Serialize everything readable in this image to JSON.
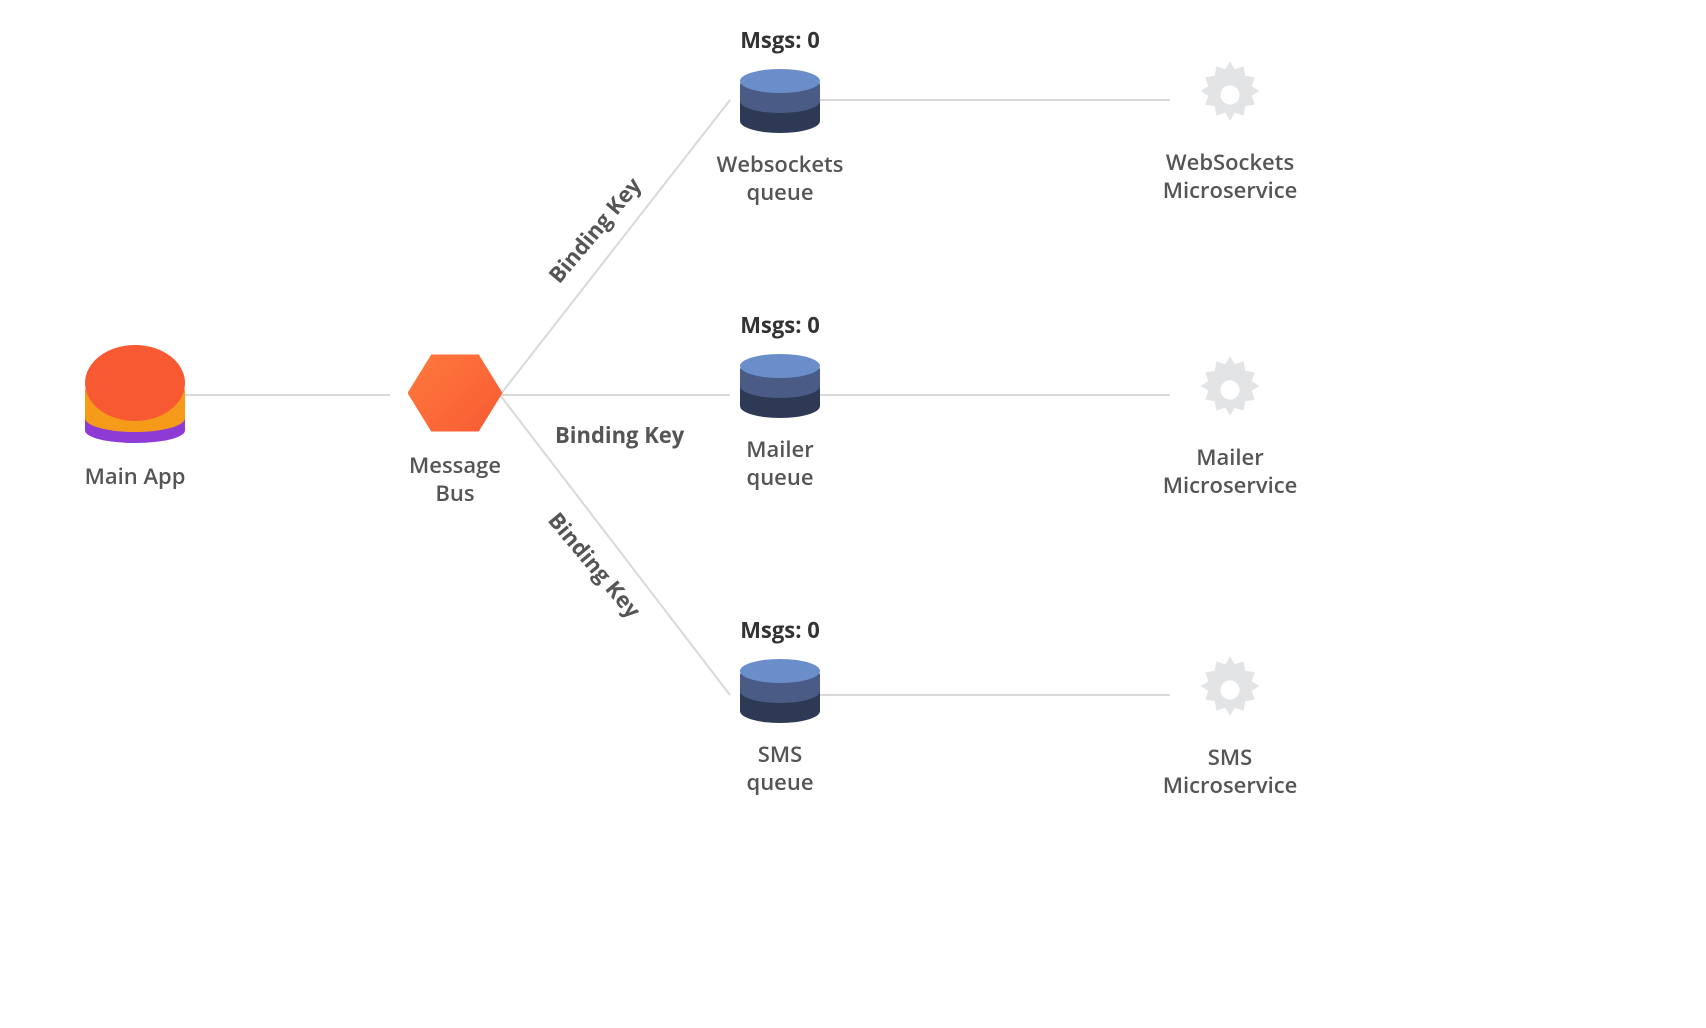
{
  "app": {
    "label": "Main App"
  },
  "bus": {
    "label_line1": "Message",
    "label_line2": "Bus"
  },
  "binding_key_label": "Binding Key",
  "queues": [
    {
      "msgs_label": "Msgs: 0",
      "label_line1": "Websockets",
      "label_line2": "queue"
    },
    {
      "msgs_label": "Msgs: 0",
      "label_line1": "Mailer",
      "label_line2": "queue"
    },
    {
      "msgs_label": "Msgs: 0",
      "label_line1": "SMS",
      "label_line2": "queue"
    }
  ],
  "services": [
    {
      "label_line1": "WebSockets",
      "label_line2": "Microservice"
    },
    {
      "label_line1": "Mailer",
      "label_line2": "Microservice"
    },
    {
      "label_line1": "SMS",
      "label_line2": "Microservice"
    },
    {
      "label_line1": "",
      "label_line2": ""
    }
  ]
}
